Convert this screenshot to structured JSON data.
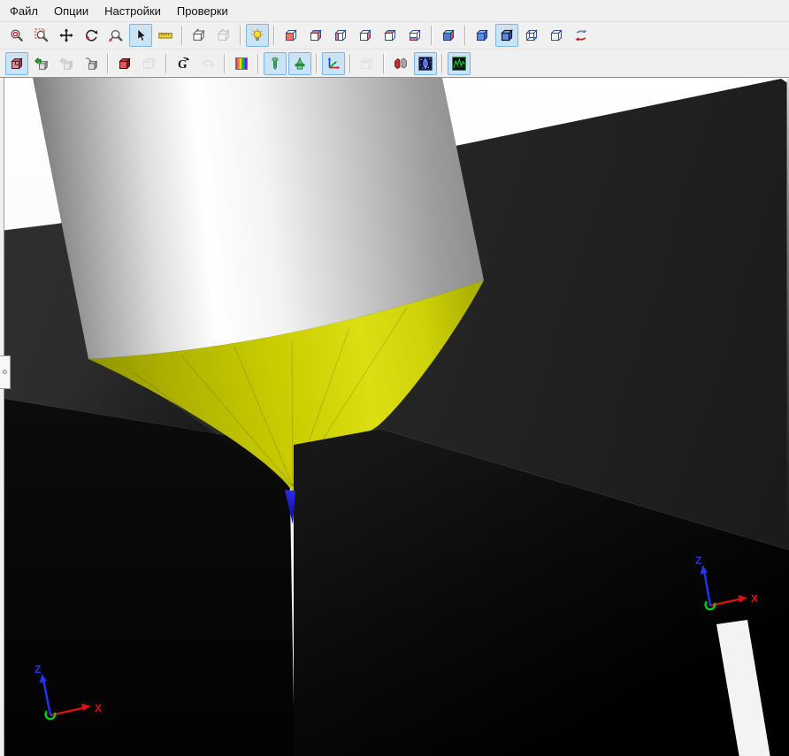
{
  "menu": {
    "items": [
      {
        "id": "file",
        "label": "Файл"
      },
      {
        "id": "options",
        "label": "Опции"
      },
      {
        "id": "settings",
        "label": "Настройки"
      },
      {
        "id": "checks",
        "label": "Проверки"
      }
    ]
  },
  "toolbar_view": {
    "buttons": [
      {
        "icon": "zoom-target-icon",
        "active": false,
        "disabled": false,
        "group_end": false
      },
      {
        "icon": "zoom-window-icon",
        "active": false,
        "disabled": false,
        "group_end": false
      },
      {
        "icon": "pan-icon",
        "active": false,
        "disabled": false,
        "group_end": false
      },
      {
        "icon": "orbit-icon",
        "active": false,
        "disabled": false,
        "group_end": false
      },
      {
        "icon": "zoom-dynamic-icon",
        "active": false,
        "disabled": false,
        "group_end": false
      },
      {
        "icon": "select-cursor-icon",
        "active": true,
        "disabled": false,
        "group_end": false
      },
      {
        "icon": "measure-icon",
        "active": false,
        "disabled": false,
        "group_end": true
      },
      {
        "icon": "section-box-icon",
        "active": false,
        "disabled": false,
        "group_end": false
      },
      {
        "icon": "section-box-alt-icon",
        "active": false,
        "disabled": true,
        "group_end": true
      },
      {
        "icon": "light-icon",
        "active": true,
        "disabled": false,
        "group_end": true
      },
      {
        "icon": "view-front-icon",
        "active": false,
        "disabled": false,
        "group_end": false
      },
      {
        "icon": "view-back-icon",
        "active": false,
        "disabled": false,
        "group_end": false
      },
      {
        "icon": "view-left-icon",
        "active": false,
        "disabled": false,
        "group_end": false
      },
      {
        "icon": "view-right-icon",
        "active": false,
        "disabled": false,
        "group_end": false
      },
      {
        "icon": "view-top-icon",
        "active": false,
        "disabled": false,
        "group_end": false
      },
      {
        "icon": "view-bottom-icon",
        "active": false,
        "disabled": false,
        "group_end": true
      },
      {
        "icon": "view-iso-icon",
        "active": false,
        "disabled": false,
        "group_end": true
      },
      {
        "icon": "render-shaded-icon",
        "active": false,
        "disabled": false,
        "group_end": false
      },
      {
        "icon": "render-shaded-edges-icon",
        "active": true,
        "disabled": false,
        "group_end": false
      },
      {
        "icon": "render-hidden-line-icon",
        "active": false,
        "disabled": false,
        "group_end": false
      },
      {
        "icon": "render-wireframe-icon",
        "active": false,
        "disabled": false,
        "group_end": false
      },
      {
        "icon": "reverse-direction-icon",
        "active": false,
        "disabled": false,
        "group_end": false
      }
    ]
  },
  "toolbar_model": {
    "buttons": [
      {
        "icon": "stock-model-icon",
        "active": true,
        "disabled": false,
        "group_end": false
      },
      {
        "icon": "load-model-icon",
        "active": false,
        "disabled": false,
        "group_end": false
      },
      {
        "icon": "load-model-alt-icon",
        "active": false,
        "disabled": true,
        "group_end": false
      },
      {
        "icon": "export-model-icon",
        "active": false,
        "disabled": false,
        "group_end": true
      },
      {
        "icon": "compare-model-icon",
        "active": false,
        "disabled": false,
        "group_end": false
      },
      {
        "icon": "compare-model-alt-icon",
        "active": false,
        "disabled": true,
        "group_end": true
      },
      {
        "icon": "rotate-g-icon",
        "active": false,
        "disabled": false,
        "group_end": false
      },
      {
        "icon": "rotate-alt-icon",
        "active": false,
        "disabled": true,
        "group_end": true
      },
      {
        "icon": "color-scale-icon",
        "active": false,
        "disabled": false,
        "group_end": true
      },
      {
        "icon": "show-tool-icon",
        "active": true,
        "disabled": false,
        "group_end": false
      },
      {
        "icon": "show-holder-icon",
        "active": true,
        "disabled": false,
        "group_end": true
      },
      {
        "icon": "show-axes-icon",
        "active": true,
        "disabled": false,
        "group_end": true
      },
      {
        "icon": "ghost-model-icon",
        "active": false,
        "disabled": true,
        "group_end": true
      },
      {
        "icon": "collision-icon",
        "active": false,
        "disabled": false,
        "group_end": false
      },
      {
        "icon": "simulation-icon",
        "active": true,
        "disabled": false,
        "group_end": true
      },
      {
        "icon": "toolpath-graph-icon",
        "active": true,
        "disabled": false,
        "group_end": false
      }
    ]
  },
  "viewport": {
    "axis_triads": [
      {
        "x_label": "X",
        "z_label": "Z"
      },
      {
        "x_label": "X",
        "z_label": "Z"
      }
    ],
    "colors": {
      "x_axis": "#dd1111",
      "z_axis": "#2233ee",
      "origin_marker": "#00cc22",
      "tool_cone": "#c9cd00",
      "tool_tip": "#1b1bd6",
      "stock_top": "#262626",
      "background": "#ffffff"
    }
  }
}
